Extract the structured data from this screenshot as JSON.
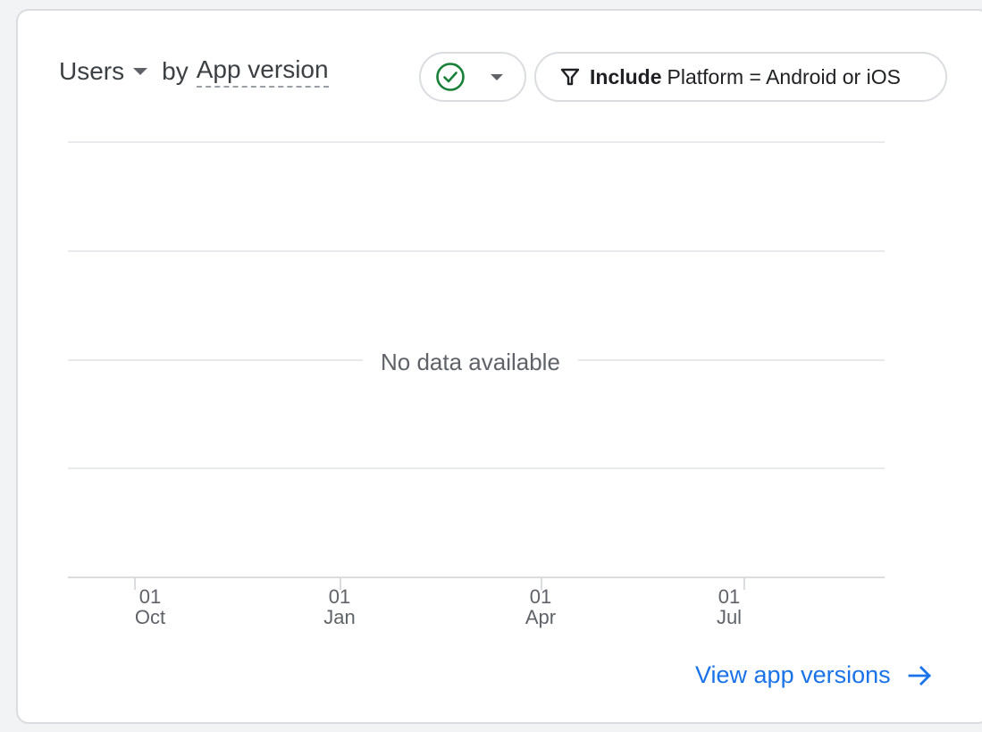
{
  "header": {
    "metric_label": "Users",
    "by_text": "by",
    "dimension_label": "App version"
  },
  "comparison_chip": {
    "icon": "check-circle-icon",
    "status_color": "#188038"
  },
  "filter_chip": {
    "icon": "funnel-icon",
    "include_label": "Include",
    "filter_text": "Platform = Android or iOS"
  },
  "chart": {
    "empty_message": "No data available",
    "x_ticks": [
      {
        "day": "01",
        "month": "Oct"
      },
      {
        "day": "01",
        "month": "Jan"
      },
      {
        "day": "01",
        "month": "Apr"
      },
      {
        "day": "01",
        "month": "Jul"
      }
    ]
  },
  "footer": {
    "link_label": "View app versions",
    "link_icon": "arrow-right-icon",
    "link_color": "#1a73e8"
  }
}
